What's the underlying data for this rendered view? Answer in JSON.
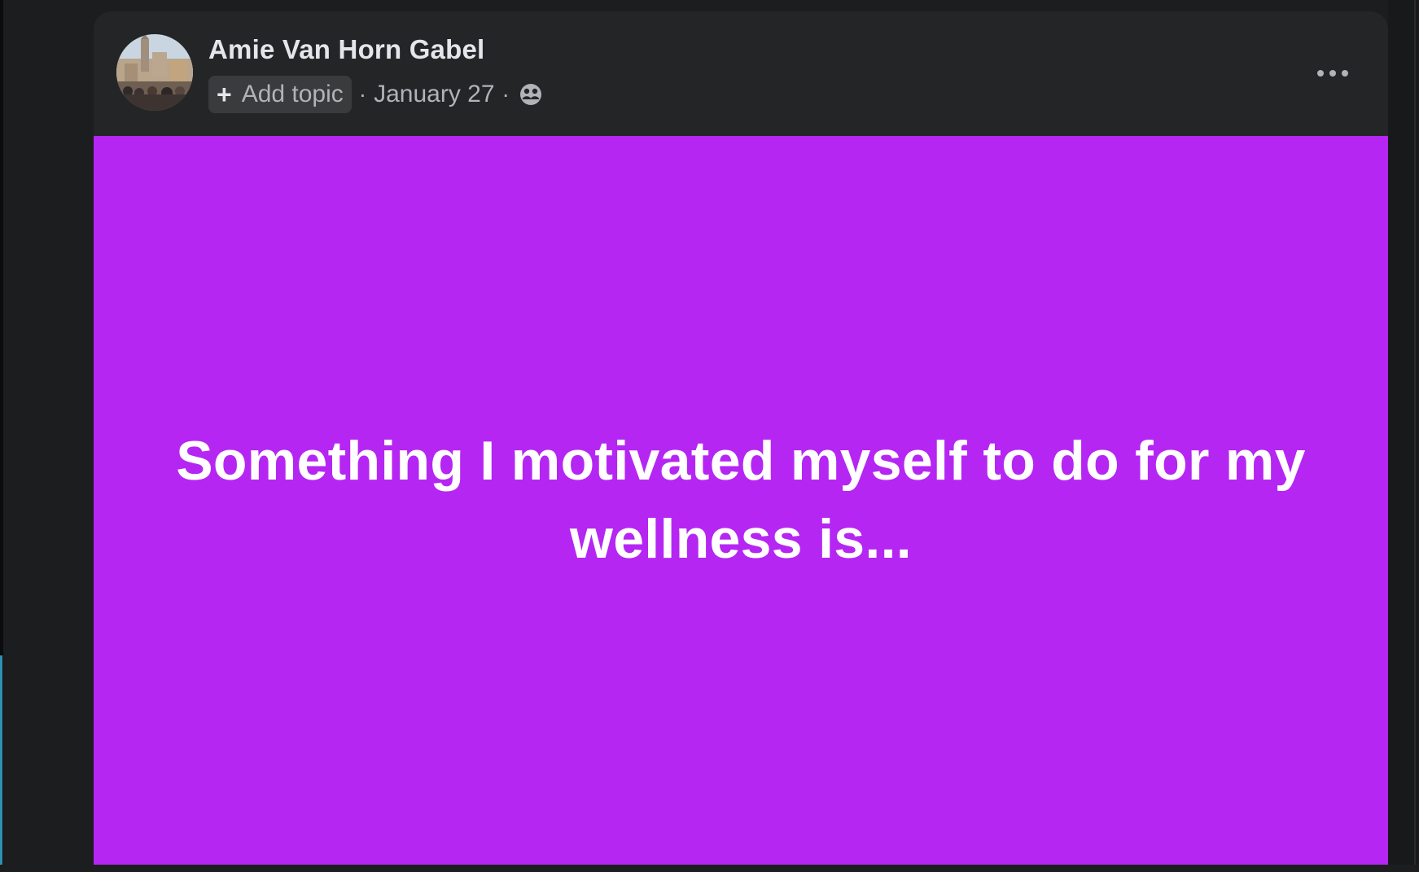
{
  "post": {
    "author": "Amie Van Horn Gabel",
    "add_topic_label": "Add topic",
    "separator": "·",
    "date": "January 27",
    "audience_icon": "friends-icon",
    "more_icon": "more-options-icon",
    "body_text": "Something I motivated myself to do for my wellness is...",
    "background_color": "#b526f3",
    "text_color": "#ffffff"
  }
}
